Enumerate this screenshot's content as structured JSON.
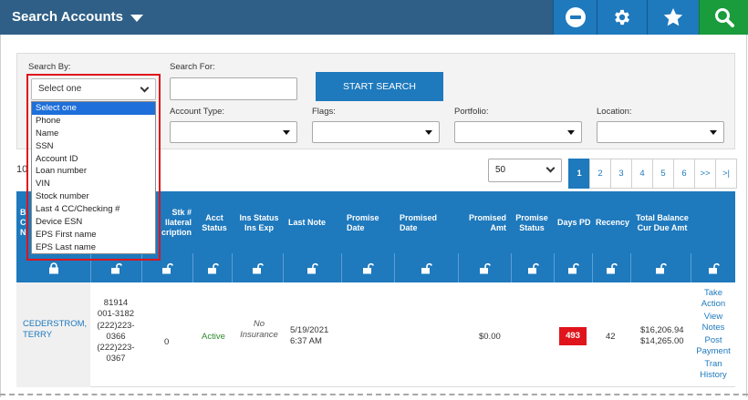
{
  "header": {
    "title": "Search Accounts",
    "buttons": [
      {
        "icon": "minus-circle-icon"
      },
      {
        "icon": "gear-icon"
      },
      {
        "icon": "star-icon"
      },
      {
        "icon": "search-icon"
      }
    ],
    "colors": {
      "bar": "#2f5f87",
      "button": "#1e79bd",
      "search": "#1a9b3c"
    }
  },
  "search": {
    "search_by_label": "Search By:",
    "search_by_value": "Select one",
    "search_for_label": "Search For:",
    "search_for_value": "",
    "start_label": "START SEARCH",
    "account_type_label": "Account Type:",
    "flags_label": "Flags:",
    "portfolio_label": "Portfolio:",
    "location_label": "Location:",
    "options": [
      "Select one",
      "Phone",
      "Name",
      "SSN",
      "Account ID",
      "Loan number",
      "VIN",
      "Stock number",
      "Last 4 CC/Checking #",
      "Device ESN",
      "EPS First name",
      "EPS Last name"
    ],
    "selected_option": "Select one"
  },
  "results": {
    "count_text": "10",
    "per_page": "50",
    "pages": [
      "1",
      "2",
      "3",
      "4",
      "5",
      "6",
      ">>",
      ">|"
    ],
    "active_page": "1"
  },
  "table": {
    "headers": {
      "col1": "B\nC\nN",
      "stk": "Stk #\nllateral\ncription",
      "acct_status": "Acct\nStatus",
      "ins_status": "Ins Status\nIns Exp",
      "last_note": "Last Note",
      "promise_date": "Promise\nDate",
      "promised_date": "Promised\nDate",
      "promised_amt": "Promised\nAmt",
      "promise_status": "Promise\nStatus",
      "days_pd": "Days PD",
      "recency": "Recency",
      "total_balance": "Total Balance\nCur Due Amt"
    },
    "row": {
      "name": "CEDERSTROM,\nTERRY",
      "ids": "81914\n001-3182\n(222)223-\n0366\n(222)223-\n0367",
      "stk": "0",
      "acct_status": "Active",
      "ins_status": "No\nInsurance",
      "last_note": "5/19/2021\n6:37 AM",
      "promised_amt": "$0.00",
      "days_pd": "493",
      "recency": "42",
      "total_balance": "$16,206.94\n$14,265.00",
      "actions": [
        "Take\nAction",
        "View\nNotes",
        "Post\nPayment",
        "Tran\nHistory"
      ]
    }
  }
}
